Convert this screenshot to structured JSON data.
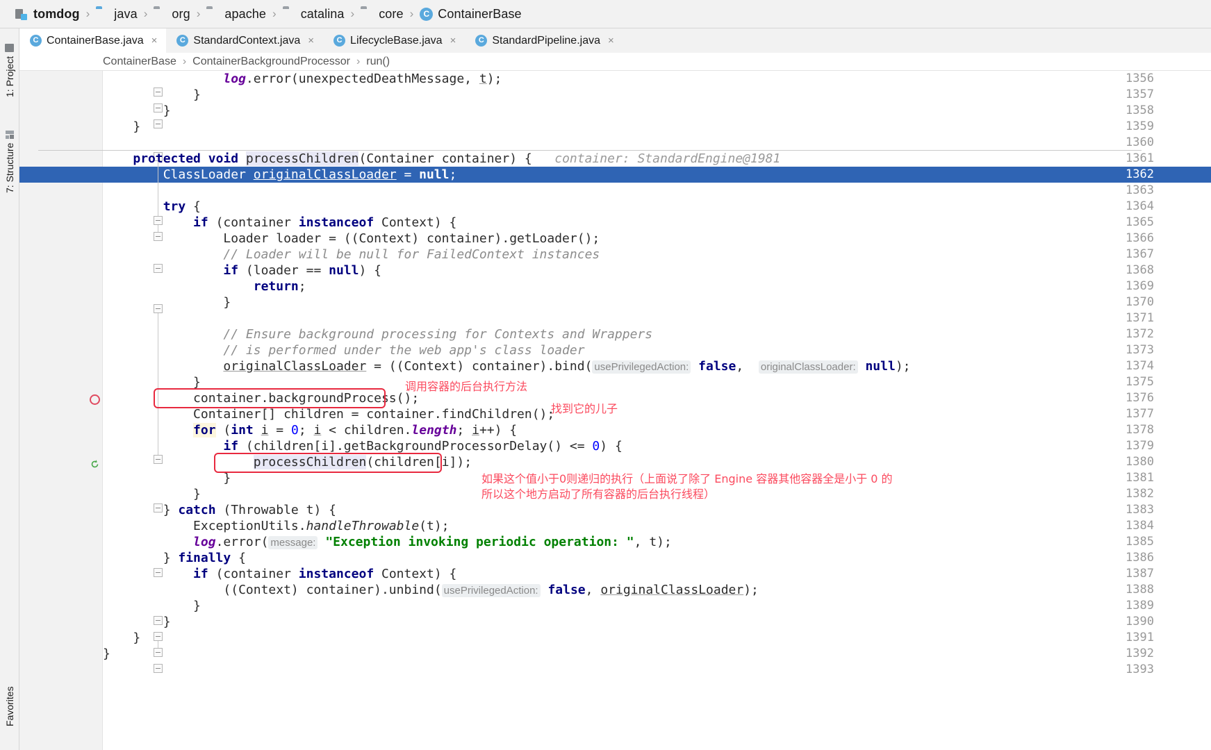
{
  "window": {
    "project_name": "tomdog"
  },
  "breadcrumb": {
    "items": [
      {
        "label": "tomdog",
        "icon": "module-icon"
      },
      {
        "label": "java",
        "icon": "folder-blue-icon"
      },
      {
        "label": "org",
        "icon": "folder-gray-icon"
      },
      {
        "label": "apache",
        "icon": "folder-gray-icon"
      },
      {
        "label": "catalina",
        "icon": "folder-gray-icon"
      },
      {
        "label": "core",
        "icon": "folder-gray-icon"
      },
      {
        "label": "ContainerBase",
        "icon": "java-class-icon"
      }
    ],
    "separator": "›"
  },
  "tabs": [
    {
      "label": "ContainerBase.java",
      "icon": "java-class-icon",
      "close": "×",
      "active": true
    },
    {
      "label": "StandardContext.java",
      "icon": "java-class-icon",
      "close": "×",
      "active": false
    },
    {
      "label": "LifecycleBase.java",
      "icon": "java-class-icon",
      "close": "×",
      "active": false
    },
    {
      "label": "StandardPipeline.java",
      "icon": "java-class-icon",
      "close": "×",
      "active": false
    }
  ],
  "structure_breadcrumb": {
    "items": [
      "ContainerBase",
      "ContainerBackgroundProcessor",
      "run()"
    ],
    "separator": "›"
  },
  "toolwindows": {
    "project": "1: Project",
    "structure": "7: Structure",
    "favorites": "Favorites"
  },
  "editor": {
    "first_line": 1356,
    "line_numbers": [
      1356,
      1357,
      1358,
      1359,
      1360,
      1361,
      1362,
      1363,
      1364,
      1365,
      1366,
      1367,
      1368,
      1369,
      1370,
      1371,
      1372,
      1373,
      1374,
      1375,
      1376,
      1377,
      1378,
      1379,
      1380,
      1381,
      1382,
      1383,
      1384,
      1385,
      1386,
      1387,
      1388,
      1389,
      1390,
      1391,
      1392,
      1393
    ],
    "caret_line": 1362,
    "breakpoint_line": 1376,
    "run_marker_line": 1380,
    "inline_hints": {
      "line_1361": "container: StandardEngine@1981",
      "use_privileged_action": "usePrivilegedAction:",
      "original_class_loader": "originalClassLoader:",
      "message": "message:"
    },
    "code_lines": [
      "                log.error(unexpectedDeathMessage, t);",
      "            }",
      "        }",
      "    }",
      "",
      "    protected void processChildren(Container container) {   container: StandardEngine@1981",
      "        ClassLoader originalClassLoader = null;",
      "",
      "        try {",
      "            if (container instanceof Context) {",
      "                Loader loader = ((Context) container).getLoader();",
      "                // Loader will be null for FailedContext instances",
      "                if (loader == null) {",
      "                    return;",
      "                }",
      "",
      "                // Ensure background processing for Contexts and Wrappers",
      "                // is performed under the web app's class loader",
      "                originalClassLoader = ((Context) container).bind( usePrivilegedAction: false,  originalClassLoader: null);",
      "            }",
      "            container.backgroundProcess();",
      "            Container[] children = container.findChildren();",
      "            for (int i = 0; i < children.length; i++) {",
      "                if (children[i].getBackgroundProcessorDelay() <= 0) {",
      "                    processChildren(children[i]);",
      "                }",
      "            }",
      "        } catch (Throwable t) {",
      "            ExceptionUtils.handleThrowable(t);",
      "            log.error( message: \"Exception invoking periodic operation: \", t);",
      "        } finally {",
      "            if (container instanceof Context) {",
      "                ((Context) container).unbind( usePrivilegedAction: false, originalClassLoader);",
      "            }",
      "        }",
      "    }",
      "}"
    ],
    "strings": {
      "exception_message": "\"Exception invoking periodic operation: \""
    }
  },
  "annotations": [
    {
      "id": "ann-background-process",
      "text": "调用容器的后台执行方法",
      "color": "#fb4a5e"
    },
    {
      "id": "ann-find-children",
      "text": "找到它的儿子",
      "color": "#fb4a5e"
    },
    {
      "id": "ann-recursive-line1",
      "text": "如果这个值小于0则递归的执行（上面说了除了 Engine 容器其他容器全是小于 0 的",
      "color": "#fb4a5e"
    },
    {
      "id": "ann-recursive-line2",
      "text": "所以这个地方启动了所有容器的后台执行线程）",
      "color": "#fb4a5e"
    }
  ],
  "colors": {
    "accent": "#3c74c8",
    "caret_row": "#2f64b4",
    "annotation_red": "#fb4a5e",
    "breakpoint_red": "#e04a5f",
    "keyword_blue": "#00007f",
    "string_green": "#008000",
    "field_purple": "#660099",
    "comment_gray": "#8c8c8c"
  }
}
